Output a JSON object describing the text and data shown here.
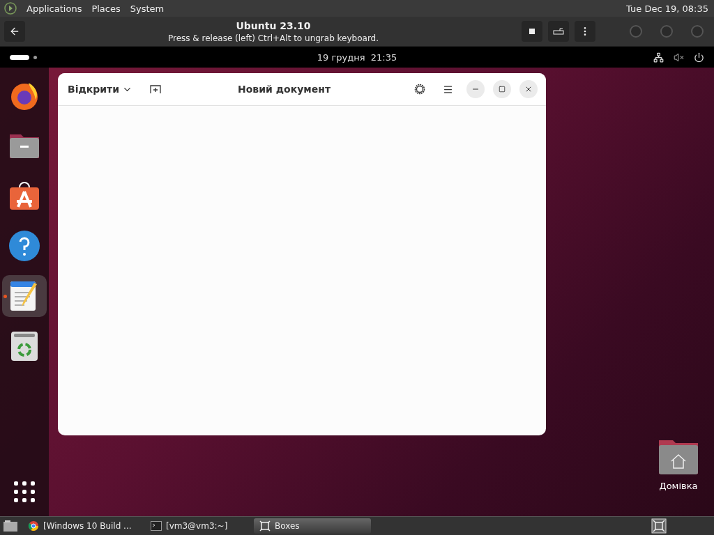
{
  "top_panel": {
    "menus": [
      "Applications",
      "Places",
      "System"
    ],
    "clock": "Tue Dec 19, 08:35"
  },
  "boxes_header": {
    "title": "Ubuntu 23.10",
    "subtitle": "Press & release (left) Ctrl+Alt to ungrab keyboard."
  },
  "guest_top_bar": {
    "date": "19 грудня",
    "time": "21:35"
  },
  "dock": [
    {
      "kind": "browser",
      "selected": false
    },
    {
      "kind": "files",
      "selected": false
    },
    {
      "kind": "store",
      "selected": false
    },
    {
      "kind": "help",
      "selected": false
    },
    {
      "kind": "editor",
      "selected": true
    },
    {
      "kind": "trash",
      "selected": false
    }
  ],
  "editor_window": {
    "open_button": "Відкрити",
    "title": "Новий документ"
  },
  "desktop_icons": [
    {
      "label": "Домівка"
    }
  ],
  "taskbar": [
    {
      "label": "[Windows 10 Build ...",
      "kind": "browser",
      "selected": false
    },
    {
      "label": "[vm3@vm3:~]",
      "kind": "terminal",
      "selected": false
    },
    {
      "label": "Boxes",
      "kind": "boxes",
      "selected": true
    }
  ]
}
